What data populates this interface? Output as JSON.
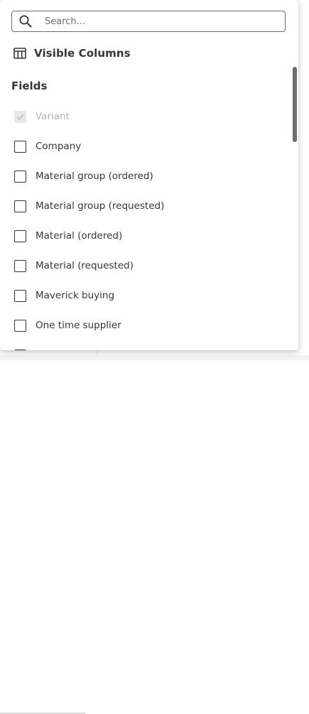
{
  "search": {
    "placeholder": "Search...",
    "value": ""
  },
  "header": {
    "title": "Visible Columns",
    "icon": "table-columns-icon"
  },
  "section": {
    "title": "Fields"
  },
  "fields": [
    {
      "label": "Variant",
      "checked": true,
      "disabled": true
    },
    {
      "label": "Company",
      "checked": false,
      "disabled": false
    },
    {
      "label": "Material group (ordered)",
      "checked": false,
      "disabled": false
    },
    {
      "label": "Material group (requested)",
      "checked": false,
      "disabled": false
    },
    {
      "label": "Material (ordered)",
      "checked": false,
      "disabled": false
    },
    {
      "label": "Material (requested)",
      "checked": false,
      "disabled": false
    },
    {
      "label": "Maverick buying",
      "checked": false,
      "disabled": false
    },
    {
      "label": "One time supplier",
      "checked": false,
      "disabled": false
    },
    {
      "label": "",
      "checked": false,
      "disabled": false
    }
  ],
  "colors": {
    "text": "#32363a",
    "disabled_text": "#b4b6b8",
    "border": "#6a6d70"
  }
}
